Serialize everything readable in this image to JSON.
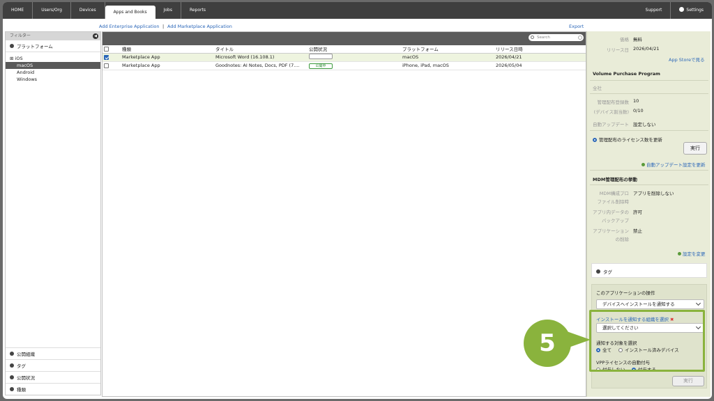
{
  "nav": {
    "items": [
      "HOME",
      "Users/Org",
      "Devices",
      "Apps and Books",
      "Jobs",
      "Reports"
    ],
    "active": "Apps and Books",
    "support": "Support",
    "settings": "Settings"
  },
  "actions": {
    "add_enterprise": "Add Enterprise Application",
    "separator": "|",
    "add_marketplace": "Add Marketplace Application",
    "export": "Export"
  },
  "sidebar": {
    "header": "フィルター",
    "platform_section": "プラットフォーム",
    "platforms": [
      "iOS",
      "macOS",
      "Android",
      "Windows"
    ],
    "selected_platform": "macOS",
    "bottom_sections": [
      "公開組織",
      "タグ",
      "公開状況",
      "種類"
    ]
  },
  "table": {
    "search_placeholder": "Search",
    "columns": [
      "種類",
      "タイトル",
      "公開状況",
      "プラットフォーム",
      "リリース日時"
    ],
    "rows": [
      {
        "checked": true,
        "type": "Marketplace App",
        "title": "Microsoft Word (16.108.1)",
        "status": "",
        "platform": "macOS",
        "release": "2026/04/21"
      },
      {
        "checked": false,
        "type": "Marketplace App",
        "title": "Goodnotes: AI Notes, Docs, PDF (7....",
        "status": "公開中",
        "platform": "iPhone, iPad, macOS",
        "release": "2026/05/04"
      }
    ]
  },
  "detail": {
    "price_label": "価格",
    "price_value": "無料",
    "release_label": "リリース日",
    "release_value": "2026/04/21",
    "appstore_link": "App Storeで見る",
    "vpp_heading": "Volume Purchase Program",
    "vpp_org": "全社",
    "mgmt_count_label": "管理配布登録数",
    "mgmt_count_value": "10",
    "device_alloc_label": "(デバイス割当数)",
    "device_alloc_value": "0/10",
    "auto_update_label": "自動アップデート",
    "auto_update_value": "設定しない",
    "license_radio": "管理配布のライセンス数を更新",
    "run_button": "実行",
    "auto_update_link": "自動アップデート設定を更新",
    "mdm_heading": "MDM管理配布の挙動",
    "mdm_profile_label_1": "MDM構成プロ",
    "mdm_profile_label_2": "ファイル削除時",
    "mdm_profile_value": "アプリを削除しない",
    "backup_label_1": "アプリ内データの",
    "backup_label_2": "バックアップ",
    "backup_value": "許可",
    "delete_label_1": "アプリケーション",
    "delete_label_2": "の削除",
    "delete_value": "禁止",
    "change_settings_link": "設定を変更",
    "tag_section": "タグ",
    "ops_heading": "このアプリケーションの操作",
    "ops_select": "デバイスへインストールを通知する",
    "org_label": "インストールを通知する組織を選択",
    "required_mark": "✖",
    "org_select": "選択してください",
    "target_label": "通知する対象を選択",
    "target_all": "全て",
    "target_installed": "インストール済みデバイス",
    "vpp_auto_label": "VPPライセンスの自動付与",
    "vpp_no": "付与しない",
    "vpp_yes": "付与する",
    "run_button_bottom": "実行"
  },
  "callout": {
    "number": "5"
  },
  "colors": {
    "accent": "#2a66b8",
    "highlight_green": "#8ab33d",
    "nav_bg": "#3f3f3f",
    "panel_bg": "#e9ecd8"
  }
}
